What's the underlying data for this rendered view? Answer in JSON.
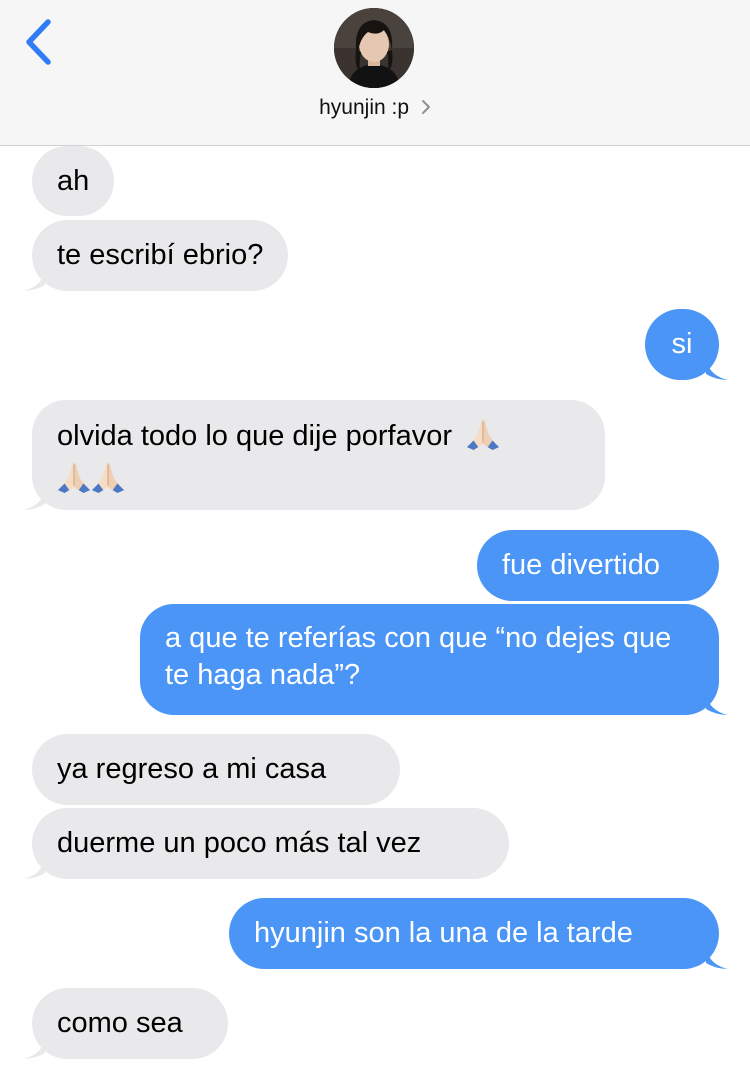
{
  "header": {
    "back_icon": "chevron-left-icon",
    "contact_name": "hyunjin :p",
    "contact_chevron_icon": "chevron-right-icon",
    "accent_color": "#2f7cf6"
  },
  "colors": {
    "incoming_bubble": "#e9e9eb",
    "outgoing_bubble": "#4a95f5"
  },
  "messages": [
    {
      "dir": "in",
      "text": "ah"
    },
    {
      "dir": "in",
      "text": "te escribí ebrio?"
    },
    {
      "dir": "out",
      "text": "si"
    },
    {
      "dir": "in",
      "text": "olvida todo lo que dije porfavor",
      "emoji_icon": "folded-hands-icon",
      "emoji_count": 3
    },
    {
      "dir": "out",
      "text": "fue divertido"
    },
    {
      "dir": "out",
      "text": "a que te referías con que “no dejes que te haga nada”?"
    },
    {
      "dir": "in",
      "text": "ya regreso a mi casa"
    },
    {
      "dir": "in",
      "text": "duerme un poco más tal vez"
    },
    {
      "dir": "out",
      "text": "hyunjin son la una de la tarde"
    },
    {
      "dir": "in",
      "text": "como sea"
    }
  ]
}
